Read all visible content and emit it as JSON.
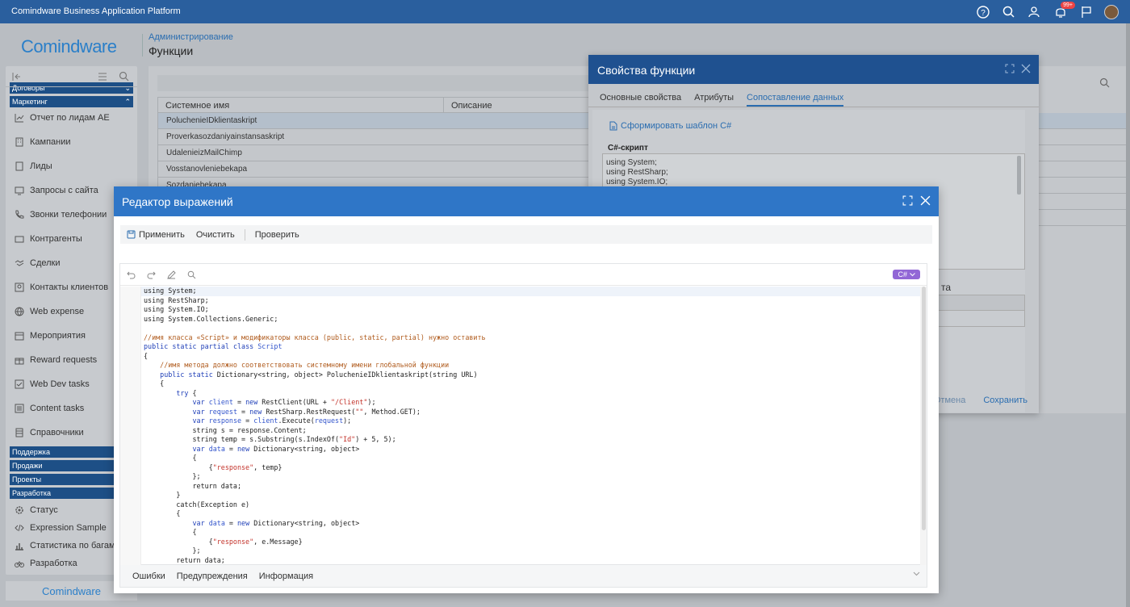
{
  "app": {
    "title": "Comindware Business Application Platform",
    "badge": "99+"
  },
  "brand": {
    "logo": "Comindware",
    "logo_bottom": "Comindware"
  },
  "breadcrumb": "Администрирование",
  "page_title": "Функции",
  "sidebar": {
    "groups_top": [
      {
        "label": "Договоры"
      },
      {
        "label": "Маркетинг"
      }
    ],
    "items": [
      {
        "label": "Отчет по лидам AE",
        "icon": "chart-icon"
      },
      {
        "label": "Кампании",
        "icon": "building-icon"
      },
      {
        "label": "Лиды",
        "icon": "document-icon"
      },
      {
        "label": "Запросы с сайта",
        "icon": "monitor-icon"
      },
      {
        "label": "Звонки телефонии",
        "icon": "phone-icon"
      },
      {
        "label": "Контрагенты",
        "icon": "folder-icon"
      },
      {
        "label": "Сделки",
        "icon": "handshake-icon"
      },
      {
        "label": "Контакты клиентов",
        "icon": "contact-icon"
      },
      {
        "label": "Web expense",
        "icon": "globe-icon"
      },
      {
        "label": "Мероприятия",
        "icon": "calendar-icon"
      },
      {
        "label": "Reward requests",
        "icon": "gift-icon"
      },
      {
        "label": "Web Dev tasks",
        "icon": "tasks-icon"
      },
      {
        "label": "Content tasks",
        "icon": "list-icon"
      },
      {
        "label": "Справочники",
        "icon": "book-icon"
      }
    ],
    "groups_bottom": [
      {
        "label": "Поддержка"
      },
      {
        "label": "Продажи"
      },
      {
        "label": "Проекты"
      },
      {
        "label": "Разработка"
      }
    ],
    "items_bottom": [
      {
        "label": "Статус",
        "icon": "gear-icon"
      },
      {
        "label": "Expression Sample",
        "icon": "code-icon"
      },
      {
        "label": "Статистика по багам",
        "icon": "stats-icon"
      },
      {
        "label": "Разработка",
        "icon": "bike-icon"
      }
    ]
  },
  "grid": {
    "headers": [
      "Системное имя",
      "Описание"
    ],
    "rows": [
      "PoluchenieIDklientaskript",
      "Proverkasozdaniyainstansaskript",
      "UdalenieizMailChimp",
      "Vosstanovleniebekapa",
      "Sozdaniebekapa"
    ]
  },
  "fprops": {
    "title": "Свойства функции",
    "tabs": [
      "Основные свойства",
      "Атрибуты",
      "Сопоставление данных"
    ],
    "generate_link": "Сформировать шаблон C#",
    "script_label": "C#-скрипт",
    "script_preview": "using System;\nusing RestSharp;\nusing System.IO;",
    "ghost_letter": "та",
    "cancel": "Отмена",
    "save": "Сохранить"
  },
  "editor": {
    "title": "Редактор выражений",
    "toolbar": {
      "apply": "Применить",
      "clear": "Очистить",
      "check": "Проверить"
    },
    "language": "C#",
    "footer": {
      "errors": "Ошибки",
      "warnings": "Предупреждения",
      "info": "Информация"
    },
    "lines": [
      "using System;",
      "using RestSharp;",
      "using System.IO;",
      "using System.Collections.Generic;",
      "",
      "//имя класса «Script» и модификаторы класса (public, static, partial) нужно оставить",
      "public static partial class Script",
      "{",
      "    //имя метода должно соответствовать системному имени глобальной функции",
      "    public static Dictionary<string, object> PoluchenieIDklientaskript(string URL)",
      "    {",
      "        try {",
      "            var client = new RestClient(URL + \"/Client\");",
      "            var request = new RestSharp.RestRequest(\"\", Method.GET);",
      "            var response = client.Execute(request);",
      "            string s = response.Content;",
      "            string temp = s.Substring(s.IndexOf(\"Id\") + 5, 5);",
      "            var data = new Dictionary<string, object>",
      "            {",
      "                {\"response\", temp}",
      "            };",
      "            return data;",
      "        }",
      "        catch(Exception e)",
      "        {",
      "            var data = new Dictionary<string, object>",
      "            {",
      "                {\"response\", e.Message}",
      "            };",
      "        return data;"
    ],
    "folds": [
      8,
      11,
      12,
      19,
      25,
      27
    ]
  }
}
